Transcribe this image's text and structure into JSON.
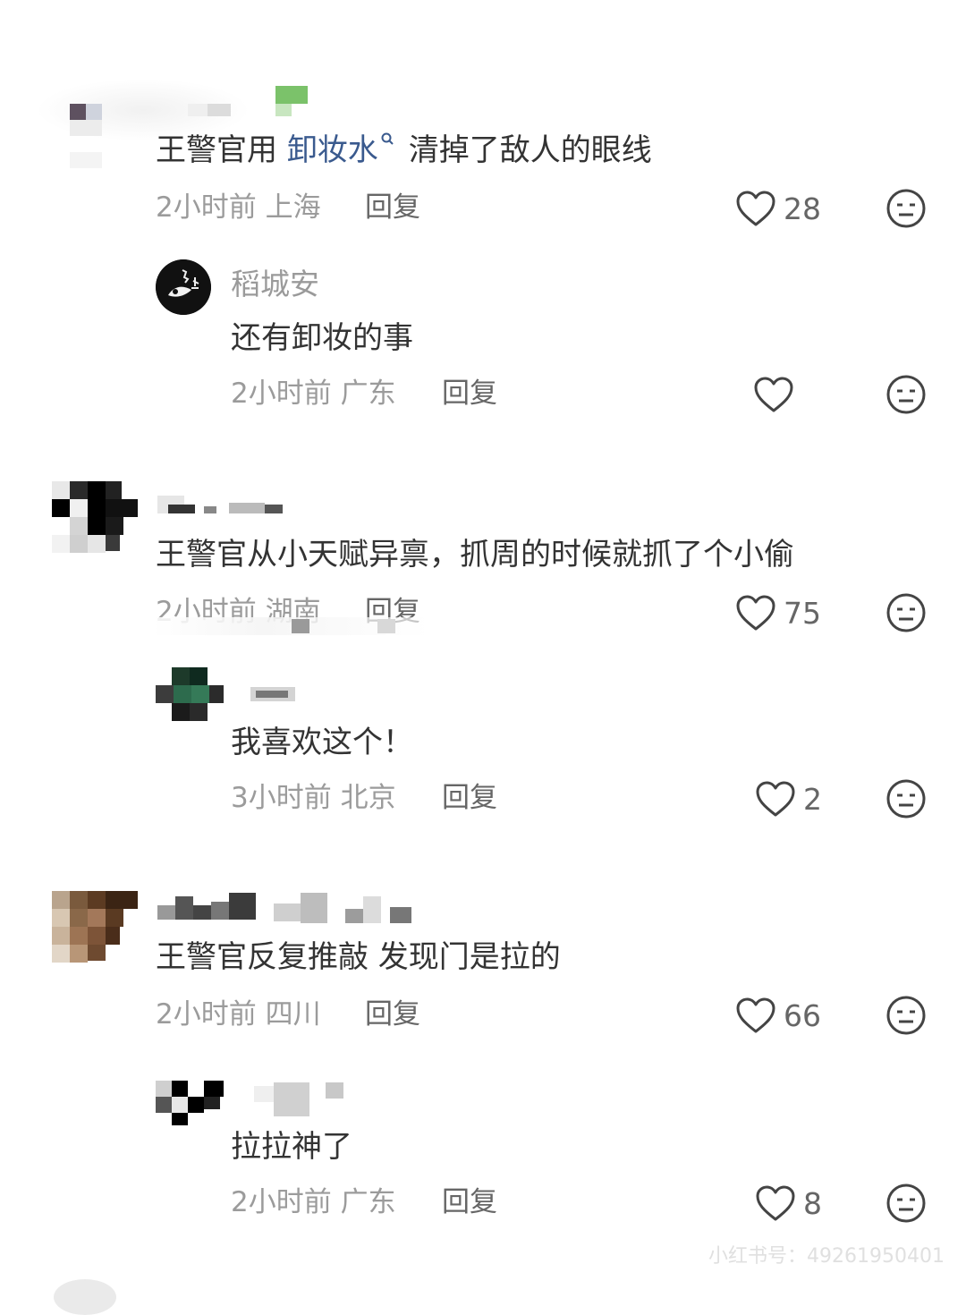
{
  "comments": [
    {
      "text_prefix": "王警官用 ",
      "link": "卸妆水",
      "text_suffix": "清掉了敌人的眼线",
      "time": "2小时前",
      "location": "上海",
      "reply_label": "回复",
      "likes": "28",
      "replies": [
        {
          "name": "稻城安",
          "text": "还有卸妆的事",
          "time": "2小时前",
          "location": "广东",
          "reply_label": "回复",
          "likes": ""
        }
      ]
    },
    {
      "text": "王警官从小天赋异禀，抓周的时候就抓了个小偷",
      "time": "2小时前",
      "location": "湖南",
      "reply_label": "回复",
      "likes": "75",
      "replies": [
        {
          "text": "我喜欢这个！",
          "time": "3小时前",
          "location": "北京",
          "reply_label": "回复",
          "likes": "2"
        }
      ]
    },
    {
      "text": "王警官反复推敲 发现门是拉的",
      "time": "2小时前",
      "location": "四川",
      "reply_label": "回复",
      "likes": "66",
      "replies": [
        {
          "text": "拉拉神了",
          "time": "2小时前",
          "location": "广东",
          "reply_label": "回复",
          "likes": "8"
        }
      ]
    }
  ],
  "watermark": "小红书号：49261950401",
  "icons": {
    "like": "heart-outline-icon",
    "emoji": "neutral-face-icon",
    "search": "search-icon"
  },
  "colors": {
    "text": "#333333",
    "meta": "#9b9b9b",
    "link": "#3a5a8e",
    "icon": "#444444"
  }
}
